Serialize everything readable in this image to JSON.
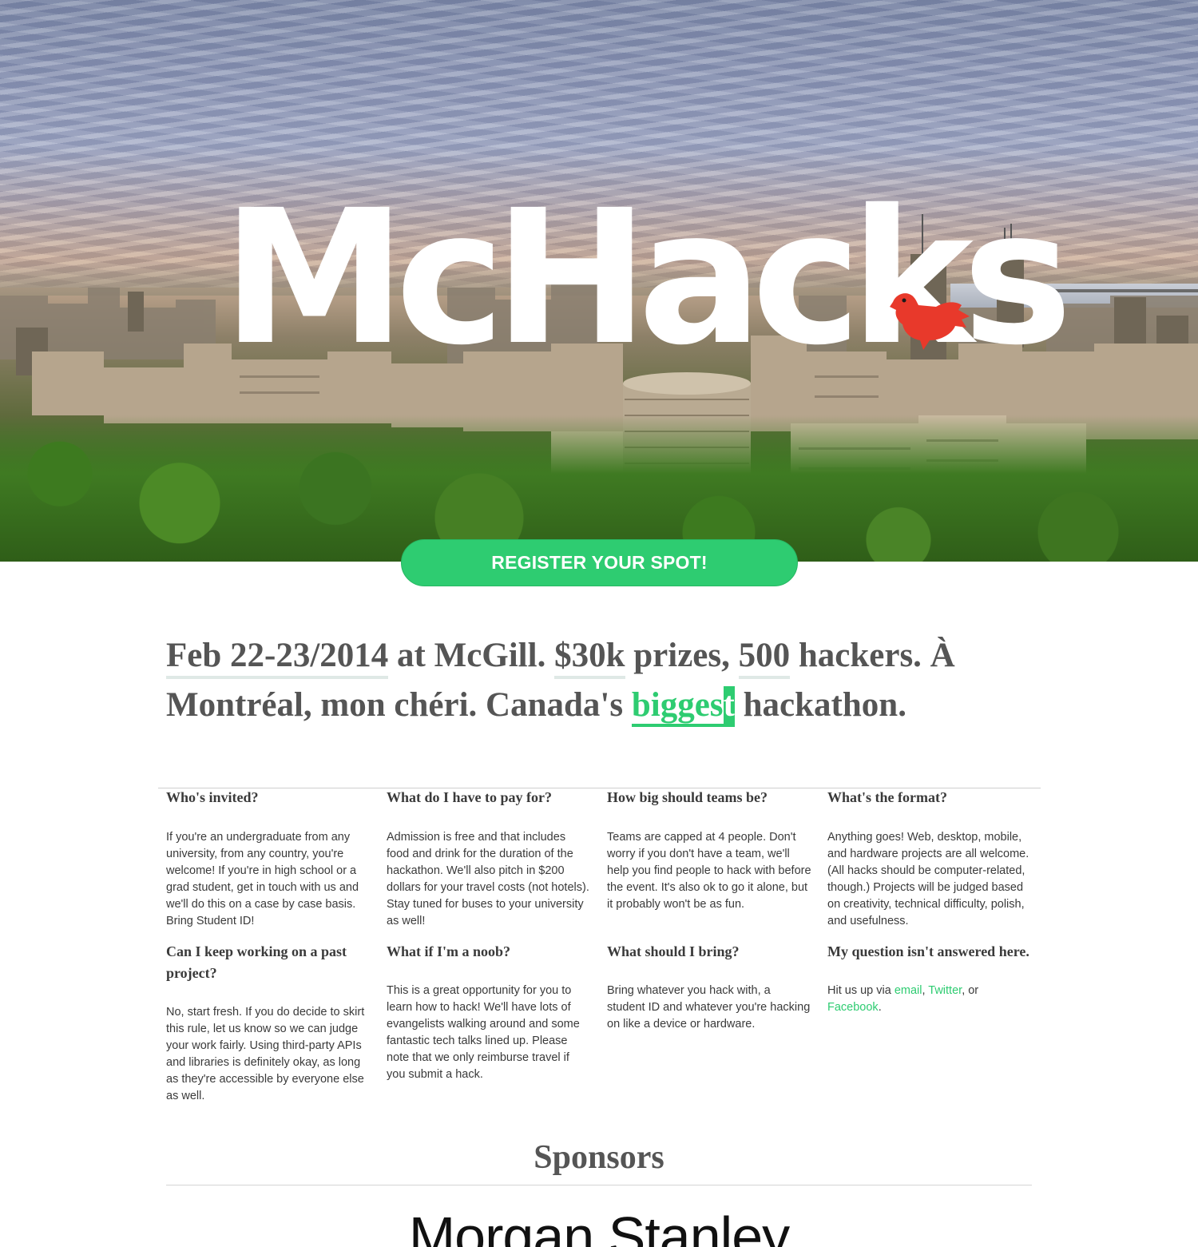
{
  "hero": {
    "logo_text": "McHacks",
    "bird_icon": "red-bird-icon",
    "register_label": "REGISTER YOUR SPOT!"
  },
  "tagline": {
    "date": "Feb 22-23/2014",
    "at": " at McGill. ",
    "prize": "$30k",
    "prizes_text": " prizes, ",
    "hackers_count": "500",
    "hackers_text": " hackers. À Montréal, mon chéri. Canada's ",
    "biggest_a": "bigges",
    "biggest_b": "t",
    "end": " hackathon."
  },
  "faq": [
    {
      "q": "Who's invited?",
      "a": "If you're an undergraduate from any university, from any country, you're welcome! If you're in high school or a grad student, get in touch with us and we'll do this on a case by case basis. Bring Student ID!"
    },
    {
      "q": "What do I have to pay for?",
      "a": "Admission is free and that includes food and drink for the duration of the hackathon. We'll also pitch in $200 dollars for your travel costs (not hotels). Stay tuned for buses to your university as well!"
    },
    {
      "q": "How big should teams be?",
      "a": "Teams are capped at 4 people. Don't worry if you don't have a team, we'll help you find people to hack with before the event. It's also ok to go it alone, but it probably won't be as fun."
    },
    {
      "q": "What's the format?",
      "a": "Anything goes! Web, desktop, mobile, and hardware projects are all welcome. (All hacks should be computer-related, though.) Projects will be judged based on creativity, technical difficulty, polish, and usefulness."
    },
    {
      "q": "Can I keep working on a past project?",
      "a": "No, start fresh. If you do decide to skirt this rule, let us know so we can judge your work fairly. Using third-party APIs and libraries is definitely okay, as long as they're accessible by everyone else as well."
    },
    {
      "q": "What if I'm a noob?",
      "a": "This is a great opportunity for you to learn how to hack! We'll have lots of evangelists walking around and some fantastic tech talks lined up. Please note that we only reimburse travel if you submit a hack."
    },
    {
      "q": "What should I bring?",
      "a": "Bring whatever you hack with, a student ID and whatever you're hacking on like a device or hardware."
    },
    {
      "q": "My question isn't answered here.",
      "a_prefix": "Hit us up via ",
      "email": "email",
      "sep1": ", ",
      "twitter": "Twitter",
      "sep2": ", or ",
      "facebook": "Facebook",
      "a_suffix": "."
    }
  ],
  "sponsors": {
    "title": "Sponsors",
    "first_sponsor": "Morgan Stanley"
  },
  "colors": {
    "accent": "#2ecc71",
    "bird": "#e8392b",
    "text": "#555555"
  }
}
